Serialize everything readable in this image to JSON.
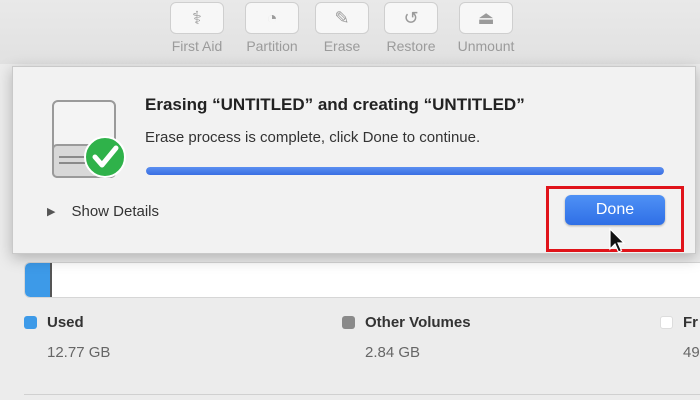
{
  "toolbar": {
    "items": [
      {
        "label": "First Aid",
        "icon": "stethoscope-icon",
        "glyph": "⚕"
      },
      {
        "label": "Partition",
        "icon": "partition-icon",
        "glyph": "◔"
      },
      {
        "label": "Erase",
        "icon": "erase-icon",
        "glyph": "✎"
      },
      {
        "label": "Restore",
        "icon": "restore-icon",
        "glyph": "↺"
      },
      {
        "label": "Unmount",
        "icon": "unmount-icon",
        "glyph": "⏏"
      }
    ]
  },
  "sheet": {
    "title": "Erasing “UNTITLED” and creating “UNTITLED”",
    "message": "Erase process is complete, click Done to continue.",
    "progress": 1.0,
    "show_details_label": "Show Details",
    "done_label": "Done"
  },
  "storage": {
    "used_fraction": 0.04,
    "legend": [
      {
        "name": "Used",
        "size": "12.77 GB",
        "color": "#3d9ae8"
      },
      {
        "name": "Other Volumes",
        "size": "2.84 GB",
        "color": "#8a8a8a"
      },
      {
        "name": "Fr",
        "size": "49",
        "color": "#ffffff"
      }
    ]
  },
  "colors": {
    "accent": "#2f6fe6",
    "highlight": "#e0141a",
    "success": "#2fb24a"
  }
}
